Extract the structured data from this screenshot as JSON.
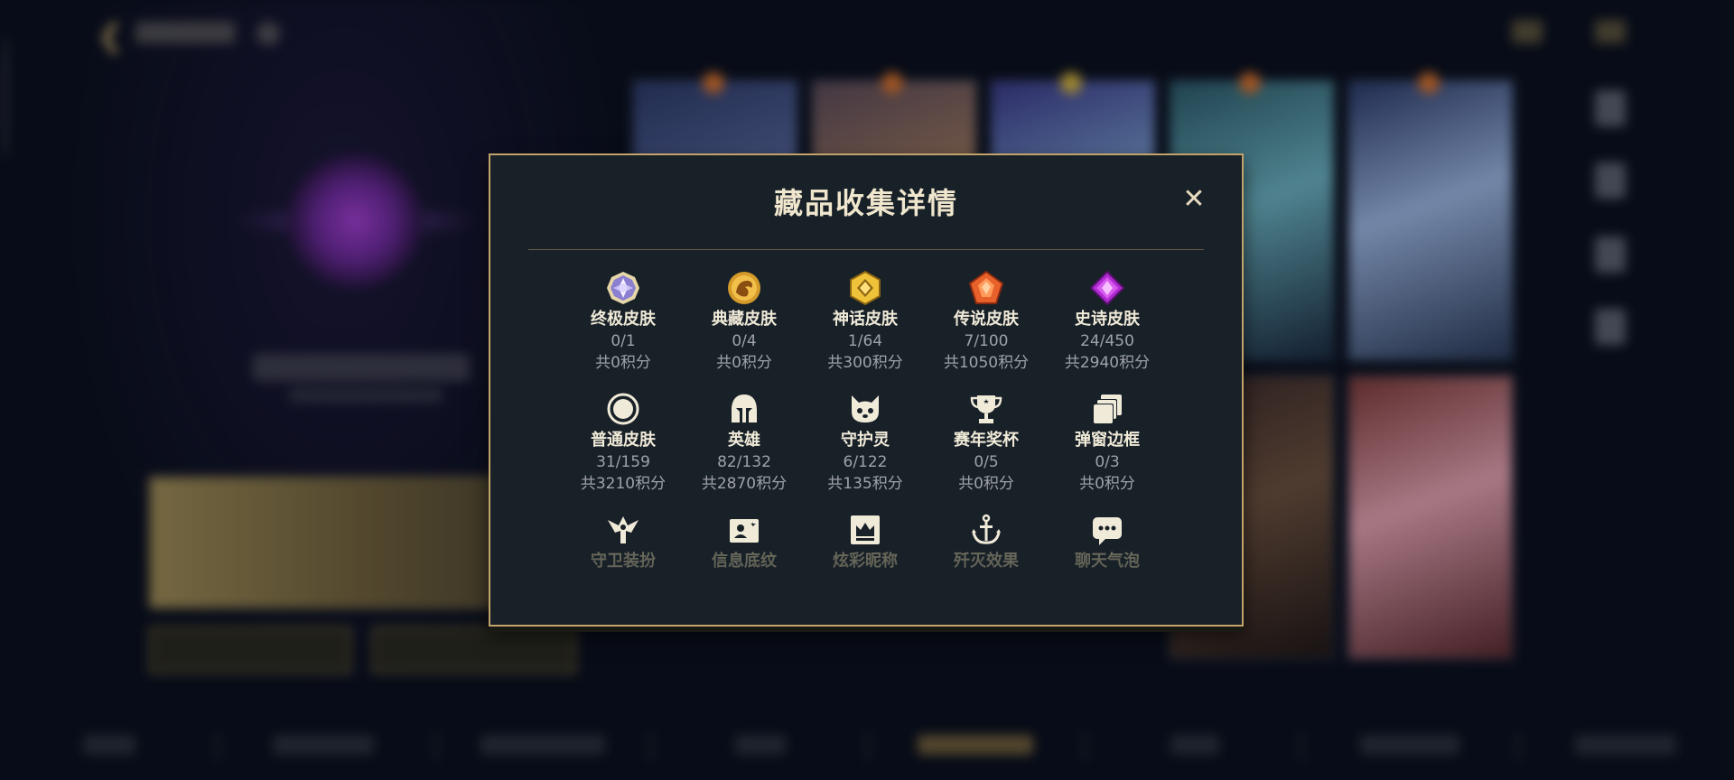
{
  "modal": {
    "title": "藏品收集详情",
    "close_label": "✕",
    "items": [
      {
        "label": "终极皮肤",
        "count": "0/1",
        "points": "共0积分",
        "icon": "ultimate-gem-icon"
      },
      {
        "label": "典藏皮肤",
        "count": "0/4",
        "points": "共0积分",
        "icon": "dragon-medallion-icon"
      },
      {
        "label": "神话皮肤",
        "count": "1/64",
        "points": "共300积分",
        "icon": "mythic-gem-icon"
      },
      {
        "label": "传说皮肤",
        "count": "7/100",
        "points": "共1050积分",
        "icon": "legendary-gem-icon"
      },
      {
        "label": "史诗皮肤",
        "count": "24/450",
        "points": "共2940积分",
        "icon": "epic-gem-icon"
      },
      {
        "label": "普通皮肤",
        "count": "31/159",
        "points": "共3210积分",
        "icon": "circle-icon"
      },
      {
        "label": "英雄",
        "count": "82/132",
        "points": "共2870积分",
        "icon": "helmet-icon"
      },
      {
        "label": "守护灵",
        "count": "6/122",
        "points": "共135积分",
        "icon": "spirit-pet-icon"
      },
      {
        "label": "赛年奖杯",
        "count": "0/5",
        "points": "共0积分",
        "icon": "trophy-icon"
      },
      {
        "label": "弹窗边框",
        "count": "0/3",
        "points": "共0积分",
        "icon": "layered-frame-icon"
      },
      {
        "label": "守卫装扮",
        "icon": "ward-icon"
      },
      {
        "label": "信息底纹",
        "icon": "id-card-icon"
      },
      {
        "label": "炫彩昵称",
        "icon": "crown-card-icon"
      },
      {
        "label": "歼灭效果",
        "icon": "anchor-icon"
      },
      {
        "label": "聊天气泡",
        "icon": "chat-bubble-icon"
      }
    ]
  },
  "colors": {
    "accent_gold": "#c2a36a",
    "modal_bg": "#182028",
    "text_primary": "#f0ead8",
    "text_secondary": "#9ea3a8"
  }
}
